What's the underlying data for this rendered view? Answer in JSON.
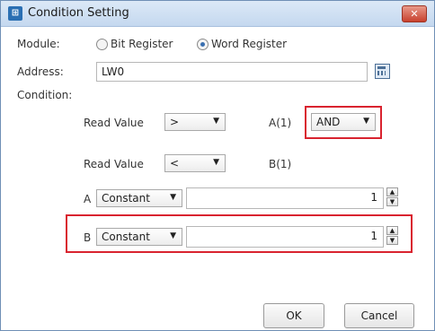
{
  "window": {
    "title": "Condition Setting",
    "app_icon": "dialog-app-icon",
    "close_icon": "close-icon"
  },
  "module": {
    "label": "Module:",
    "options": [
      {
        "label": "Bit Register",
        "checked": false
      },
      {
        "label": "Word Register",
        "checked": true
      }
    ]
  },
  "address": {
    "label": "Address:",
    "value": "LW0",
    "icon": "calculator-icon"
  },
  "condition": {
    "label": "Condition:",
    "row1": {
      "label": "Read Value",
      "operator": ">",
      "operand": "A(1)",
      "logic": "AND"
    },
    "row2": {
      "label": "Read Value",
      "operator": "<",
      "operand": "B(1)"
    }
  },
  "param_a": {
    "label": "A",
    "type": "Constant",
    "value": "1"
  },
  "param_b": {
    "label": "B",
    "type": "Constant",
    "value": "1"
  },
  "buttons": {
    "ok": "OK",
    "cancel": "Cancel"
  },
  "colors": {
    "highlight": "#d9232f",
    "titlebar": "#c4d8ef"
  }
}
